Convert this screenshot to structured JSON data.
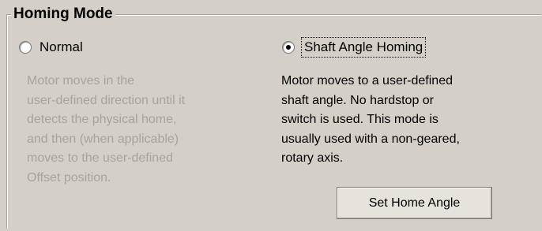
{
  "group": {
    "title": "Homing Mode"
  },
  "options": {
    "normal": {
      "label": "Normal",
      "checked": false,
      "description": [
        "Motor moves in the",
        "user-defined direction until it",
        "detects the physical home,",
        "and then (when applicable)",
        "moves to the user-defined",
        "Offset position."
      ]
    },
    "shaft_angle": {
      "label": "Shaft Angle Homing",
      "checked": true,
      "description": [
        "Motor moves to a user-defined",
        "shaft angle. No hardstop or",
        "switch is used. This mode is",
        "usually used with a non-geared,",
        "rotary axis."
      ]
    }
  },
  "buttons": {
    "set_home_angle": "Set Home Angle"
  },
  "colors": {
    "background": "#d4d0c8",
    "disabled_text": "#a7a49d",
    "text": "#000000"
  }
}
